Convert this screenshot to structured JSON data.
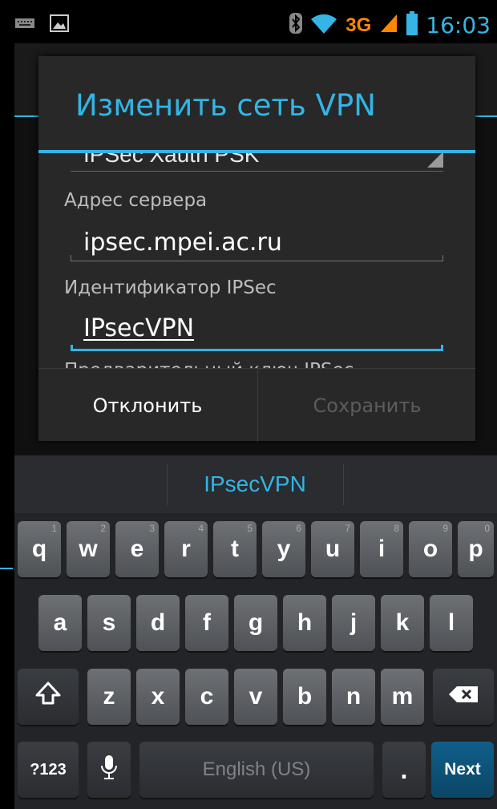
{
  "status_bar": {
    "keyboard_notification_icon": "keyboard-icon",
    "image_notification_icon": "image-icon",
    "bluetooth_icon": "bluetooth-icon",
    "wifi_icon": "wifi-icon",
    "network_type": "3G",
    "signal_icon": "signal-icon",
    "battery_icon": "battery-icon",
    "time": "16:03",
    "accent_color": "#33b5e5",
    "network_color": "#ff8800"
  },
  "dialog": {
    "title": "Изменить сеть VPN",
    "type_value_partial": "IPSec Xauth PSK",
    "fields": [
      {
        "label": "Адрес сервера",
        "value": "ipsec.mpei.ac.ru"
      },
      {
        "label": "Идентификатор IPSec",
        "value": "IPsecVPN"
      }
    ],
    "cut_off_label": "Предварительный ключ IPSec",
    "cancel_label": "Отклонить",
    "save_label": "Сохранить"
  },
  "keyboard": {
    "suggestion": "IPsecVPN",
    "row1": [
      {
        "key": "q",
        "hint": "1"
      },
      {
        "key": "w",
        "hint": "2"
      },
      {
        "key": "e",
        "hint": "3"
      },
      {
        "key": "r",
        "hint": "4"
      },
      {
        "key": "t",
        "hint": "5"
      },
      {
        "key": "y",
        "hint": "6"
      },
      {
        "key": "u",
        "hint": "7"
      },
      {
        "key": "i",
        "hint": "8"
      },
      {
        "key": "o",
        "hint": "9"
      },
      {
        "key": "p",
        "hint": "0"
      }
    ],
    "row2": [
      "a",
      "s",
      "d",
      "f",
      "g",
      "h",
      "j",
      "k",
      "l"
    ],
    "row3": [
      "z",
      "x",
      "c",
      "v",
      "b",
      "n",
      "m"
    ],
    "shift_icon": "shift-icon",
    "backspace_icon": "backspace-icon",
    "mic_icon": "microphone-icon",
    "symbols_label": "?123",
    "space_label": "English (US)",
    "period_label": ".",
    "next_label": "Next"
  }
}
